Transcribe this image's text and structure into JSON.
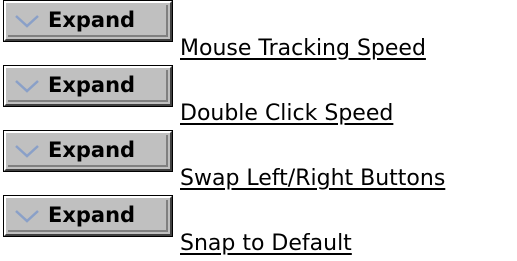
{
  "rows": [
    {
      "button_label": "Expand",
      "link_text": "Mouse Tracking Speed"
    },
    {
      "button_label": "Expand",
      "link_text": "Double Click Speed"
    },
    {
      "button_label": "Expand",
      "link_text": "Swap Left/Right Buttons"
    },
    {
      "button_label": "Expand",
      "link_text": "Snap to Default"
    }
  ],
  "icons": {
    "expand": "chevron-down-icon"
  },
  "colors": {
    "button_face": "#c0c0c0",
    "chevron": "#8aa0c8",
    "text": "#000000"
  }
}
